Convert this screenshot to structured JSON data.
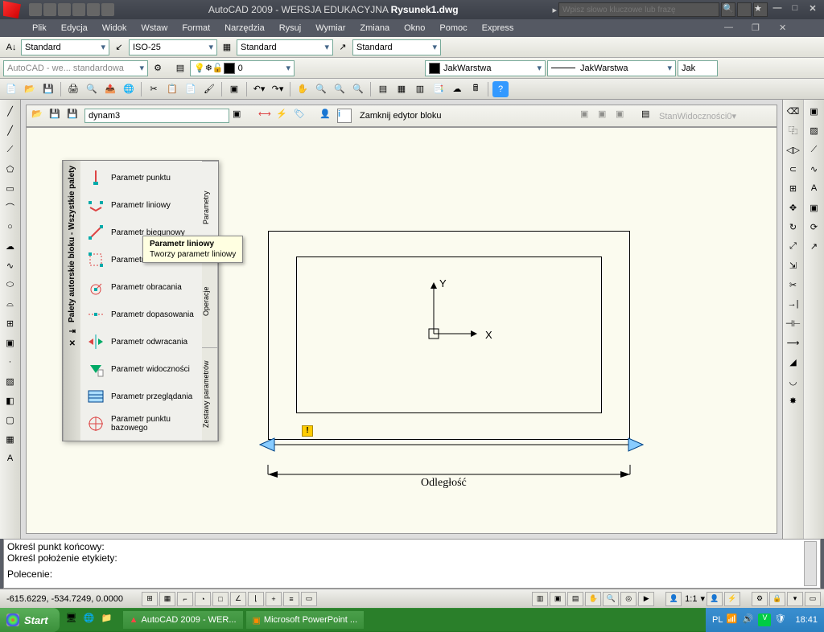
{
  "title": {
    "app": "AutoCAD 2009 - WERSJA EDUKACYJNA",
    "file": "Rysunek1.dwg"
  },
  "search_placeholder": "Wpisz słowo kluczowe lub frazę",
  "menu": [
    "Plik",
    "Edycja",
    "Widok",
    "Wstaw",
    "Format",
    "Narzędzia",
    "Rysuj",
    "Wymiar",
    "Zmiana",
    "Okno",
    "Pomoc",
    "Express"
  ],
  "style_bar": {
    "text_style": "Standard",
    "dim_style": "ISO-25",
    "table_style": "Standard",
    "ml_style": "Standard"
  },
  "layer_bar": {
    "workspace": "AutoCAD - we... standardowa",
    "layer_name": "0",
    "color_name": "JakWarstwa",
    "linetype": "JakWarstwa",
    "lineweight": "Jak"
  },
  "block_editor": {
    "name": "dynam3",
    "close_label": "Zamknij edytor bloku",
    "vis_state": "StanWidoczności0"
  },
  "palette": {
    "title": "Palety autorskie bloku - Wszystkie palety",
    "tabs": [
      "Parametry",
      "Operacje",
      "Zestawy parametrów"
    ],
    "items": [
      "Parametr punktu",
      "Parametr liniowy",
      "Parametr biegunowy",
      "Parametr XY",
      "Parametr obracania",
      "Parametr dopasowania",
      "Parametr odwracania",
      "Parametr widoczności",
      "Parametr przeglądania",
      "Parametr punktu bazowego"
    ]
  },
  "tooltip": {
    "title": "Parametr liniowy",
    "desc": "Tworzy parametr liniowy"
  },
  "drawing": {
    "dim_label": "Odległość",
    "x_label": "X",
    "y_label": "Y"
  },
  "cmd": {
    "line1": "Określ punkt końcowy:",
    "line2": "Określ położenie etykiety:",
    "prompt": "Polecenie:"
  },
  "status": {
    "coords": "-615.6229, -534.7249, 0.0000",
    "scale": "1:1"
  },
  "taskbar": {
    "start": "Start",
    "tasks": [
      "AutoCAD 2009 - WER...",
      "Microsoft PowerPoint ..."
    ],
    "lang": "PL",
    "time": "18:41"
  }
}
